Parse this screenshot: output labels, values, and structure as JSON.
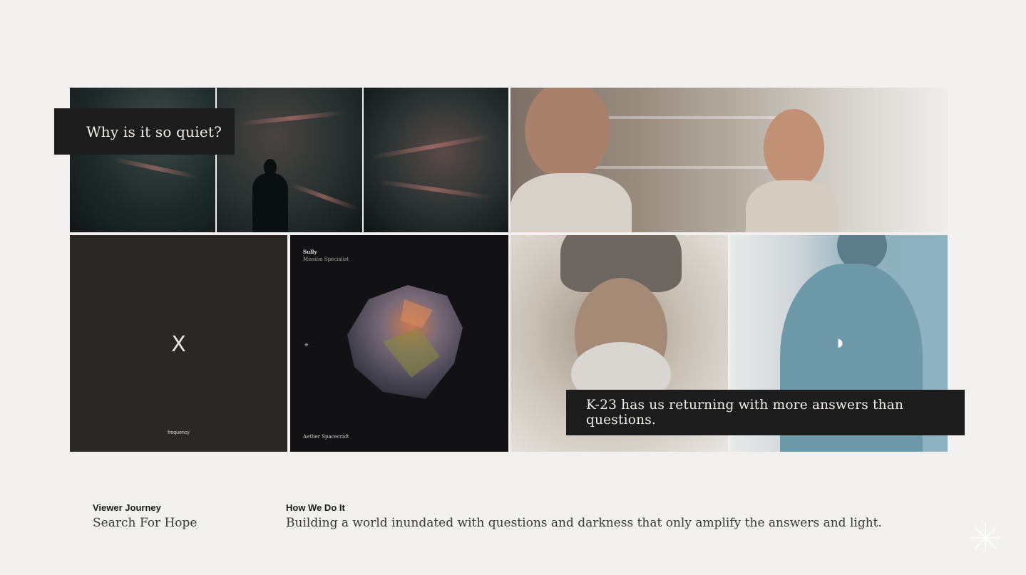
{
  "captions": {
    "top_left": "Why is it so quiet?",
    "bottom_right": "K-23 has us returning with more answers than questions."
  },
  "tiles": {
    "frequency": {
      "symbol": "X",
      "label": "frequency"
    },
    "card": {
      "name": "Sully",
      "role": "Mission Specialist",
      "footer": "Aether Spacecraft"
    }
  },
  "footer": {
    "left": {
      "label": "Viewer Journey",
      "value": "Search For Hope"
    },
    "right": {
      "label": "How We Do It",
      "value": "Building a world inundated with questions and darkness that only amplify the answers and light."
    }
  },
  "icons": {
    "corner": "sparkle-icon",
    "satellite": "satellite-icon",
    "moon": "crescent-moon-icon"
  }
}
